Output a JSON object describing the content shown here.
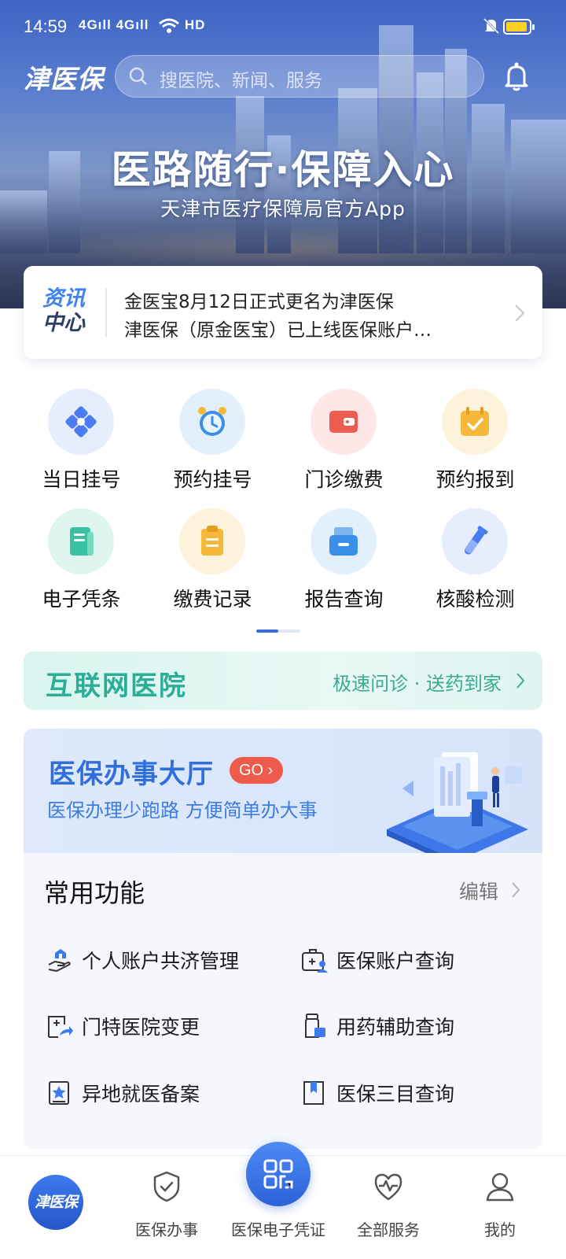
{
  "status_bar": {
    "time": "14:59",
    "signal_text": "4Gıll 4Gıll",
    "hd_label": "HD",
    "battery_color": "#ffd020"
  },
  "header": {
    "app_logo": "津医保",
    "search_placeholder": "搜医院、新闻、服务",
    "bell_icon": "bell-icon"
  },
  "banner": {
    "slogan": "医路随行·保障入心",
    "subtitle": "天津市医疗保障局官方App"
  },
  "news": {
    "tag_line1": "资讯",
    "tag_line2": "中心",
    "items": [
      "金医宝8月12日正式更名为津医保",
      "津医保（原金医宝）已上线医保账户…"
    ]
  },
  "grid": {
    "items": [
      {
        "label": "当日挂号",
        "icon": "registration-icon",
        "bg": "#e6edfc",
        "color": "#4a7cf0"
      },
      {
        "label": "预约挂号",
        "icon": "alarm-clock-icon",
        "bg": "#e3f0fb",
        "color": "#3a8fe8"
      },
      {
        "label": "门诊缴费",
        "icon": "wallet-icon",
        "bg": "#fde8e7",
        "color": "#ef5b4f"
      },
      {
        "label": "预约报到",
        "icon": "calendar-check-icon",
        "bg": "#fdf2dc",
        "color": "#f5b83a"
      },
      {
        "label": "电子凭条",
        "icon": "receipt-icon",
        "bg": "#dff5ef",
        "color": "#39c1a1"
      },
      {
        "label": "缴费记录",
        "icon": "clipboard-icon",
        "bg": "#fdf2dc",
        "color": "#f5b83a"
      },
      {
        "label": "报告查询",
        "icon": "report-tray-icon",
        "bg": "#e3f0fb",
        "color": "#3a8fe8"
      },
      {
        "label": "核酸检测",
        "icon": "test-tube-icon",
        "bg": "#e6edfc",
        "color": "#4a7cf0"
      }
    ],
    "page_indicator": {
      "pages": 2,
      "active": 1
    }
  },
  "internet_hospital": {
    "title": "互联网医院",
    "subtitle": "极速问诊 · 送药到家"
  },
  "service_hall": {
    "title": "医保办事大厅",
    "go_label": "GO",
    "subtitle": "医保办理少跑路 方便简单办大事"
  },
  "common_functions": {
    "title": "常用功能",
    "edit_label": "编辑",
    "items": [
      {
        "label": "个人账户共济管理",
        "icon": "hand-sharing-icon"
      },
      {
        "label": "医保账户查询",
        "icon": "medical-kit-user-icon"
      },
      {
        "label": "门特医院变更",
        "icon": "hospital-transfer-icon"
      },
      {
        "label": "用药辅助查询",
        "icon": "medicine-bottle-icon"
      },
      {
        "label": "异地就医备案",
        "icon": "star-document-icon"
      },
      {
        "label": "医保三目查询",
        "icon": "bookmark-book-icon"
      }
    ]
  },
  "bottom_nav": {
    "home_label": "津医保",
    "items": [
      {
        "label": "医保办事",
        "icon": "shield-check-icon"
      },
      {
        "label": "医保电子凭证",
        "icon": "qr-code-icon"
      },
      {
        "label": "全部服务",
        "icon": "heart-pulse-icon"
      },
      {
        "label": "我的",
        "icon": "user-icon"
      }
    ]
  }
}
